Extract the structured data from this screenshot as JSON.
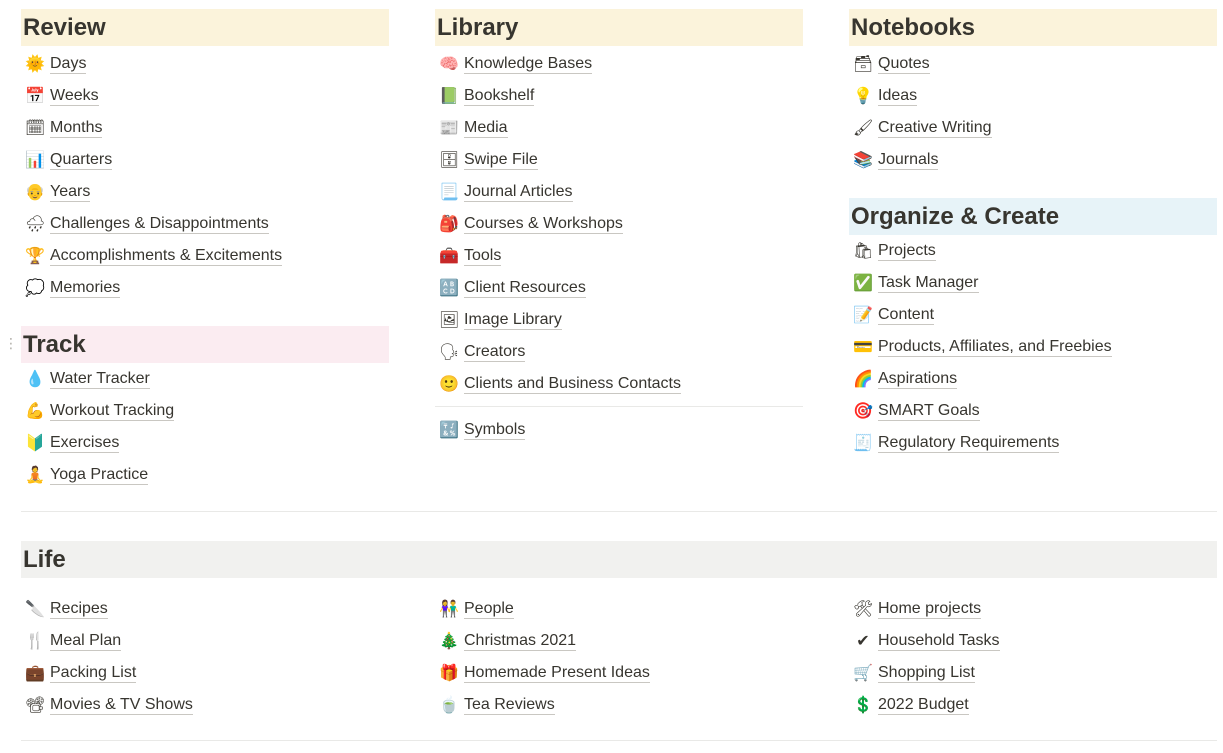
{
  "review": {
    "title": "Review",
    "items": [
      {
        "icon": "🌞",
        "icon_name": "sun-with-face-icon",
        "label": "Days"
      },
      {
        "icon": "📅",
        "icon_name": "calendar-icon",
        "label": "Weeks"
      },
      {
        "icon": "🗓",
        "icon_name": "spiral-calendar-icon",
        "label": "Months"
      },
      {
        "icon": "📊",
        "icon_name": "bar-chart-icon",
        "label": "Quarters"
      },
      {
        "icon": "👴",
        "icon_name": "older-person-icon",
        "label": "Years"
      },
      {
        "icon": "🌧",
        "icon_name": "rain-cloud-icon",
        "label": "Challenges & Disappointments"
      },
      {
        "icon": "🏆",
        "icon_name": "trophy-icon",
        "label": "Accomplishments & Excitements"
      },
      {
        "icon": "💭",
        "icon_name": "thought-bubble-icon",
        "label": "Memories"
      }
    ]
  },
  "track": {
    "title": "Track",
    "items": [
      {
        "icon": "💧",
        "icon_name": "droplet-icon",
        "label": "Water Tracker"
      },
      {
        "icon": "💪",
        "icon_name": "flexed-biceps-icon",
        "label": "Workout Tracking"
      },
      {
        "icon": "🔰",
        "icon_name": "beginner-symbol-icon",
        "label": "Exercises"
      },
      {
        "icon": "🧘",
        "icon_name": "person-lotus-icon",
        "label": "Yoga Practice"
      }
    ]
  },
  "library": {
    "title": "Library",
    "items": [
      {
        "icon": "🧠",
        "icon_name": "brain-icon",
        "label": "Knowledge Bases"
      },
      {
        "icon": "📗",
        "icon_name": "green-book-icon",
        "label": "Bookshelf"
      },
      {
        "icon": "📰",
        "icon_name": "newspaper-icon",
        "label": "Media"
      },
      {
        "icon": "🗄",
        "icon_name": "file-cabinet-icon",
        "label": "Swipe File"
      },
      {
        "icon": "📃",
        "icon_name": "page-curl-icon",
        "label": "Journal Articles"
      },
      {
        "icon": "🎒",
        "icon_name": "backpack-icon",
        "label": "Courses & Workshops"
      },
      {
        "icon": "🧰",
        "icon_name": "toolbox-icon",
        "label": "Tools"
      },
      {
        "icon": "🔠",
        "icon_name": "abcd-letters-icon",
        "label": "Client Resources"
      },
      {
        "icon": "🖼",
        "icon_name": "framed-picture-icon",
        "label": "Image Library"
      },
      {
        "icon": "🗣",
        "icon_name": "speaking-head-icon",
        "label": "Creators"
      },
      {
        "icon": "🙂",
        "icon_name": "smiling-face-icon",
        "label": "Clients and Business Contacts"
      }
    ],
    "extra": [
      {
        "icon": "🔣",
        "icon_name": "symbols-icon",
        "label": "Symbols"
      }
    ]
  },
  "notebooks": {
    "title": "Notebooks",
    "items": [
      {
        "icon": "🗃",
        "icon_name": "card-file-box-icon",
        "label": "Quotes"
      },
      {
        "icon": "💡",
        "icon_name": "light-bulb-icon",
        "label": "Ideas"
      },
      {
        "icon": "🖌",
        "icon_name": "paintbrush-icon",
        "label": "Creative Writing"
      },
      {
        "icon": "📚",
        "icon_name": "books-icon",
        "label": "Journals"
      }
    ]
  },
  "organize": {
    "title": "Organize & Create",
    "items": [
      {
        "icon": "🛍",
        "icon_name": "shopping-bags-icon",
        "label": "Projects"
      },
      {
        "icon": "✅",
        "icon_name": "check-mark-button-icon",
        "label": "Task Manager"
      },
      {
        "icon": "📝",
        "icon_name": "memo-icon",
        "label": "Content"
      },
      {
        "icon": "💳",
        "icon_name": "credit-card-icon",
        "label": "Products, Affiliates, and Freebies"
      },
      {
        "icon": "🌈",
        "icon_name": "rainbow-icon",
        "label": "Aspirations"
      },
      {
        "icon": "🎯",
        "icon_name": "target-icon",
        "label": "SMART Goals"
      },
      {
        "icon": "🧾",
        "icon_name": "receipt-icon",
        "label": "Regulatory Requirements"
      }
    ]
  },
  "life": {
    "title": "Life",
    "col1": [
      {
        "icon": "🔪",
        "icon_name": "kitchen-knife-icon",
        "label": "Recipes"
      },
      {
        "icon": "🍴",
        "icon_name": "fork-and-knife-icon",
        "label": "Meal Plan"
      },
      {
        "icon": "💼",
        "icon_name": "briefcase-icon",
        "label": "Packing List"
      },
      {
        "icon": "📽",
        "icon_name": "film-projector-icon",
        "label": "Movies & TV Shows"
      }
    ],
    "col2": [
      {
        "icon": "👫",
        "icon_name": "people-holding-hands-icon",
        "label": "People"
      },
      {
        "icon": "🎄",
        "icon_name": "christmas-tree-icon",
        "label": "Christmas 2021"
      },
      {
        "icon": "🎁",
        "icon_name": "wrapped-gift-icon",
        "label": "Homemade Present Ideas"
      },
      {
        "icon": "🍵",
        "icon_name": "teacup-icon",
        "label": "Tea Reviews"
      }
    ],
    "col3": [
      {
        "icon": "🛠",
        "icon_name": "hammer-and-wrench-icon",
        "label": "Home projects"
      },
      {
        "icon": "✔",
        "icon_name": "check-mark-icon",
        "label": "Household Tasks"
      },
      {
        "icon": "🛒",
        "icon_name": "shopping-cart-icon",
        "label": "Shopping List"
      },
      {
        "icon": "💲",
        "icon_name": "dollar-sign-icon",
        "label": "2022 Budget"
      }
    ]
  },
  "colors": {
    "yellow_heading": "#fbf3db",
    "pink_heading": "#fbecf1",
    "blue_heading": "#e7f3f8",
    "gray_heading": "#f1f1ef",
    "text": "#37352f"
  }
}
